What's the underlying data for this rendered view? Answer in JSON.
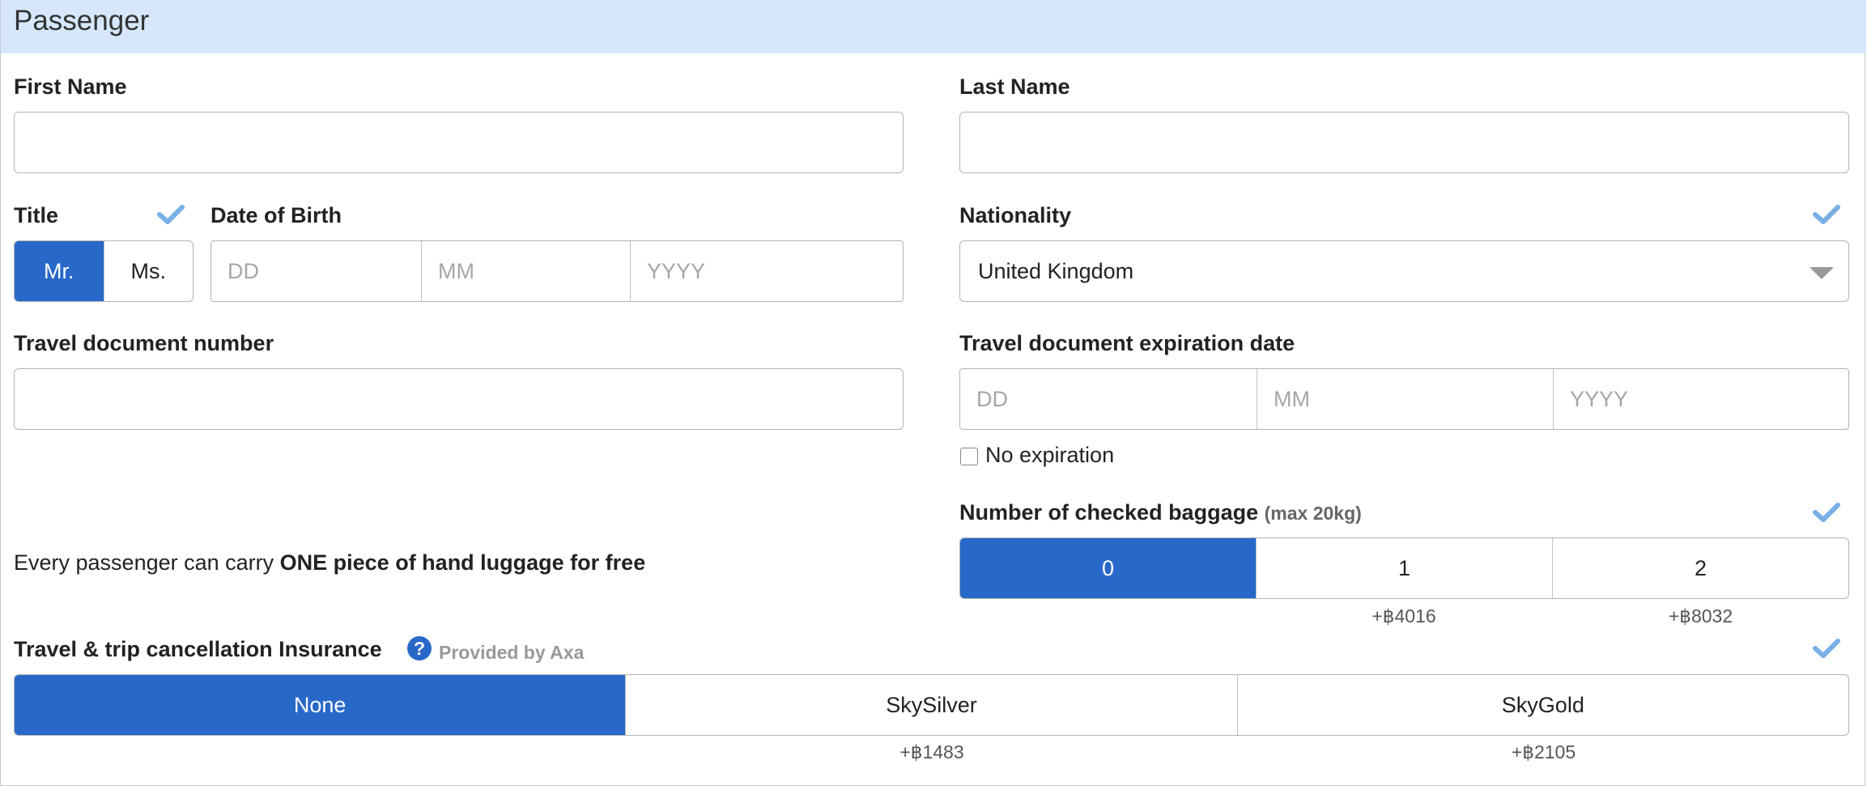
{
  "section": {
    "title": "Passenger"
  },
  "first_name": {
    "label": "First Name",
    "value": ""
  },
  "last_name": {
    "label": "Last Name",
    "value": ""
  },
  "title_field": {
    "label": "Title",
    "options": [
      "Mr.",
      "Ms."
    ],
    "selected": "Mr."
  },
  "dob": {
    "label": "Date of Birth",
    "placeholders": {
      "dd": "DD",
      "mm": "MM",
      "yyyy": "YYYY"
    }
  },
  "nationality": {
    "label": "Nationality",
    "value": "United Kingdom"
  },
  "travel_doc": {
    "label": "Travel document number",
    "value": ""
  },
  "doc_expiry": {
    "label": "Travel document expiration date",
    "placeholders": {
      "dd": "DD",
      "mm": "MM",
      "yyyy": "YYYY"
    },
    "no_expiration_label": "No expiration",
    "no_expiration_checked": false
  },
  "baggage": {
    "label": "Number of checked baggage",
    "note": "(max 20kg)",
    "options": [
      {
        "label": "0",
        "price": ""
      },
      {
        "label": "1",
        "price": "+฿4016"
      },
      {
        "label": "2",
        "price": "+฿8032"
      }
    ],
    "selected": "0"
  },
  "hand_luggage": {
    "prefix": "Every passenger can carry ",
    "emphasis": "ONE piece of hand luggage for free"
  },
  "insurance": {
    "label": "Travel & trip cancellation Insurance",
    "help_icon": "question-circle-icon",
    "provider": "Provided by Axa",
    "options": [
      {
        "label": "None",
        "price": ""
      },
      {
        "label": "SkySilver",
        "price": "+฿1483"
      },
      {
        "label": "SkyGold",
        "price": "+฿2105"
      }
    ],
    "selected": "None"
  },
  "colors": {
    "accent": "#2868c8",
    "header_bg": "#d6e7fc",
    "check": "#7aaee6"
  }
}
